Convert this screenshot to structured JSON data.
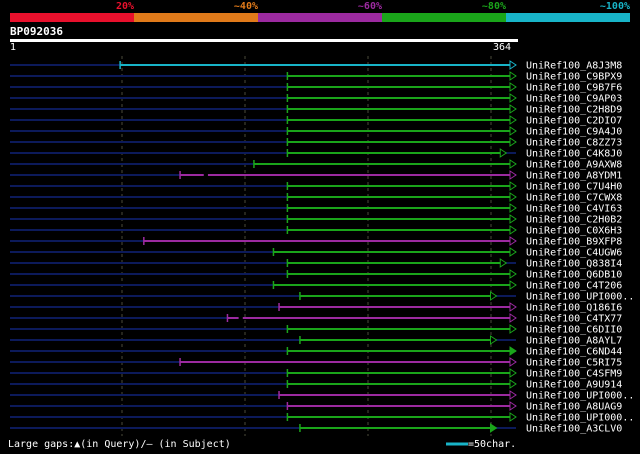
{
  "scale": {
    "labels": [
      "20%",
      "~40%",
      "~60%",
      "~80%",
      "~100%"
    ],
    "colors": [
      "#e8102c",
      "#e07a1a",
      "#9c2aa0",
      "#1aa51a",
      "#18b4c8"
    ]
  },
  "query": {
    "id": "BP092036",
    "start": "1",
    "end": "364"
  },
  "colors": {
    "cyan": "#18b4c8",
    "green": "#1aa51a",
    "purple": "#9c2aa0",
    "gap": "#0c1a5a",
    "grid": "#4a4a3a"
  },
  "hits": [
    {
      "name": "UniRef100_A8J3M8",
      "start": 80,
      "end": 364,
      "color": "cyan",
      "arrow": "open"
    },
    {
      "name": "UniRef100_C9BPX9",
      "start": 200,
      "end": 364,
      "color": "green",
      "arrow": "open"
    },
    {
      "name": "UniRef100_C9B7F6",
      "start": 200,
      "end": 364,
      "color": "green",
      "arrow": "open"
    },
    {
      "name": "UniRef100_C9AP03",
      "start": 200,
      "end": 364,
      "color": "green",
      "arrow": "open"
    },
    {
      "name": "UniRef100_C2H8D9",
      "start": 200,
      "end": 364,
      "color": "green",
      "arrow": "open"
    },
    {
      "name": "UniRef100_C2DIO7",
      "start": 200,
      "end": 364,
      "color": "green",
      "arrow": "open"
    },
    {
      "name": "UniRef100_C9A4J0",
      "start": 200,
      "end": 364,
      "color": "green",
      "arrow": "open"
    },
    {
      "name": "UniRef100_C8ZZ73",
      "start": 200,
      "end": 364,
      "color": "green",
      "arrow": "open"
    },
    {
      "name": "UniRef100_C4K8J0",
      "start": 200,
      "end": 357,
      "color": "green",
      "arrow": "open"
    },
    {
      "name": "UniRef100_A9AXW8",
      "start": 176,
      "end": 364,
      "color": "green",
      "arrow": "open"
    },
    {
      "name": "UniRef100_A8YDM1",
      "start": 123,
      "end": 364,
      "color": "purple",
      "arrow": "open",
      "gap": [
        140,
        143
      ]
    },
    {
      "name": "UniRef100_C7U4H0",
      "start": 200,
      "end": 364,
      "color": "green",
      "arrow": "open"
    },
    {
      "name": "UniRef100_C7CWX8",
      "start": 200,
      "end": 364,
      "color": "green",
      "arrow": "open"
    },
    {
      "name": "UniRef100_C4VI63",
      "start": 200,
      "end": 364,
      "color": "green",
      "arrow": "open"
    },
    {
      "name": "UniRef100_C2H0B2",
      "start": 200,
      "end": 364,
      "color": "green",
      "arrow": "open"
    },
    {
      "name": "UniRef100_C0X6H3",
      "start": 200,
      "end": 364,
      "color": "green",
      "arrow": "open"
    },
    {
      "name": "UniRef100_B9XFP8",
      "start": 97,
      "end": 364,
      "color": "purple",
      "arrow": "open"
    },
    {
      "name": "UniRef100_C4UGW6",
      "start": 190,
      "end": 364,
      "color": "green",
      "arrow": "open"
    },
    {
      "name": "UniRef100_Q838I4",
      "start": 200,
      "end": 357,
      "color": "green",
      "arrow": "open"
    },
    {
      "name": "UniRef100_Q6DB10",
      "start": 200,
      "end": 364,
      "color": "green",
      "arrow": "open"
    },
    {
      "name": "UniRef100_C4T206",
      "start": 190,
      "end": 364,
      "color": "green",
      "arrow": "open"
    },
    {
      "name": "UniRef100_UPI000..",
      "start": 209,
      "end": 350,
      "color": "green",
      "arrow": "open"
    },
    {
      "name": "UniRef100_Q186I6",
      "start": 194,
      "end": 364,
      "color": "purple",
      "arrow": "open"
    },
    {
      "name": "UniRef100_C4TX77",
      "start": 157,
      "end": 364,
      "color": "purple",
      "arrow": "open",
      "gap": [
        165,
        168
      ]
    },
    {
      "name": "UniRef100_C6DII0",
      "start": 200,
      "end": 364,
      "color": "green",
      "arrow": "open"
    },
    {
      "name": "UniRef100_A8AYL7",
      "start": 209,
      "end": 350,
      "color": "green",
      "arrow": "open"
    },
    {
      "name": "UniRef100_C6ND44",
      "start": 200,
      "end": 364,
      "color": "green",
      "arrow": "none"
    },
    {
      "name": "UniRef100_C5RI75",
      "start": 123,
      "end": 364,
      "color": "purple",
      "arrow": "open"
    },
    {
      "name": "UniRef100_C4SFM9",
      "start": 200,
      "end": 364,
      "color": "green",
      "arrow": "open"
    },
    {
      "name": "UniRef100_A9U914",
      "start": 200,
      "end": 364,
      "color": "green",
      "arrow": "open"
    },
    {
      "name": "UniRef100_UPI000..",
      "start": 194,
      "end": 364,
      "color": "purple",
      "arrow": "open"
    },
    {
      "name": "UniRef100_A8UAG9",
      "start": 200,
      "end": 364,
      "color": "purple",
      "arrow": "open"
    },
    {
      "name": "UniRef100_UPI000..",
      "start": 200,
      "end": 364,
      "color": "green",
      "arrow": "open"
    },
    {
      "name": "UniRef100_A3CLV0",
      "start": 209,
      "end": 350,
      "color": "green",
      "arrow": "none"
    }
  ],
  "footer": {
    "gaps_text": "Large gaps:▲(in Query)/– (in Subject)",
    "key_text": "=50char."
  }
}
